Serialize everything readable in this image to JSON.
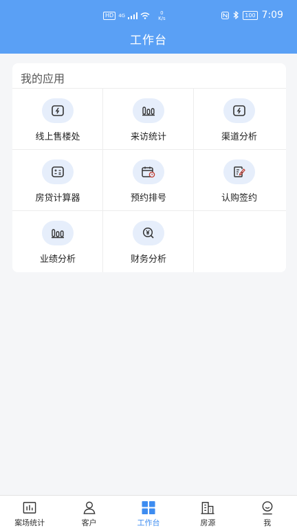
{
  "status_bar": {
    "hd": "HD",
    "network": "4G",
    "speed_value": "0",
    "speed_unit": "K/s",
    "battery": "100",
    "time": "7:09"
  },
  "header": {
    "title": "工作台"
  },
  "apps_section": {
    "title": "我的应用",
    "items": [
      {
        "label": "线上售楼处",
        "icon": "bolt-screen-icon"
      },
      {
        "label": "来访统计",
        "icon": "bar-chart-icon"
      },
      {
        "label": "渠道分析",
        "icon": "bolt-screen-icon"
      },
      {
        "label": "房贷计算器",
        "icon": "calculator-icon"
      },
      {
        "label": "预约排号",
        "icon": "calendar-clock-icon"
      },
      {
        "label": "认购签约",
        "icon": "sign-document-icon"
      },
      {
        "label": "业绩分析",
        "icon": "bar-chart-icon"
      },
      {
        "label": "财务分析",
        "icon": "yen-search-icon"
      }
    ]
  },
  "bottom_nav": {
    "active_index": 2,
    "active_color": "#3d8cf0",
    "items": [
      {
        "label": "案场统计",
        "icon": "stats-board-icon"
      },
      {
        "label": "客户",
        "icon": "person-icon"
      },
      {
        "label": "工作台",
        "icon": "grid-icon"
      },
      {
        "label": "房源",
        "icon": "building-icon"
      },
      {
        "label": "我",
        "icon": "profile-icon"
      }
    ]
  }
}
